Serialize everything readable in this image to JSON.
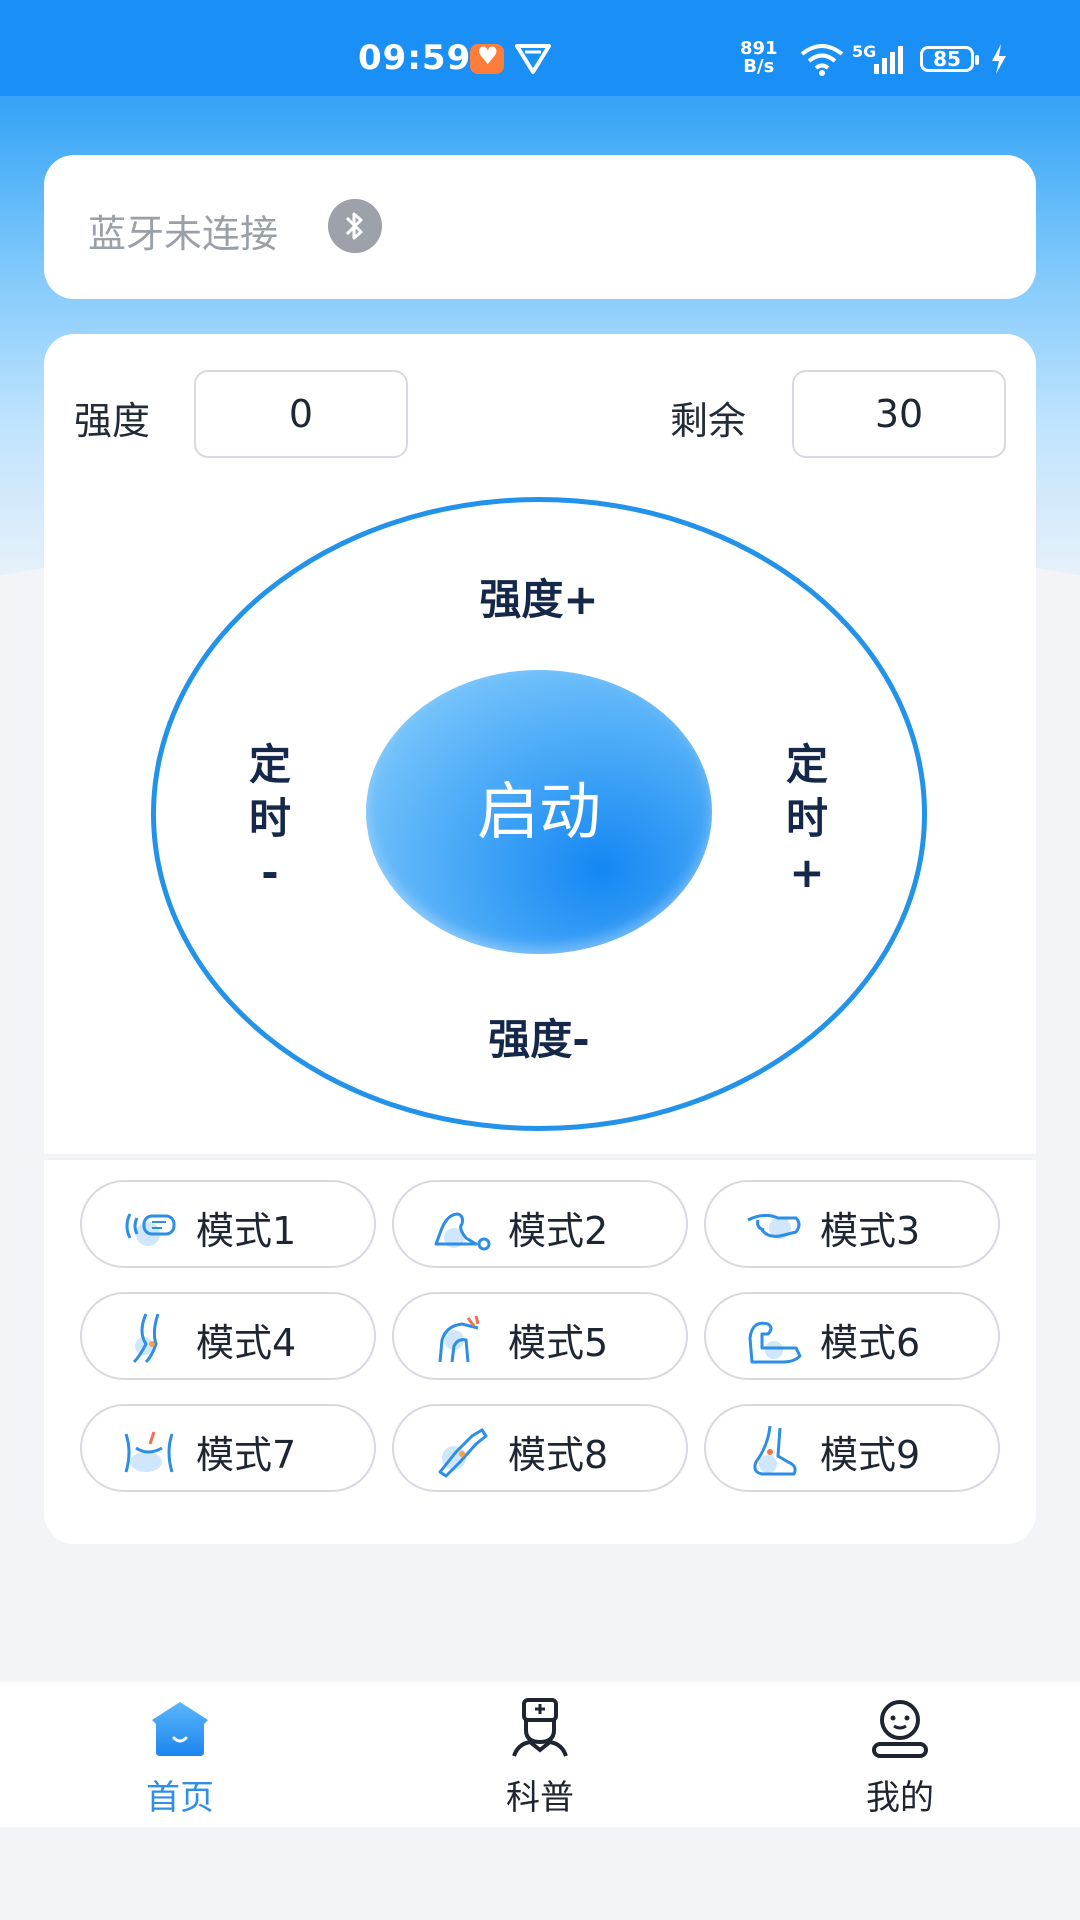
{
  "status_bar": {
    "time": "09:59",
    "net_speed_value": "891",
    "net_speed_unit": "B/s",
    "network_type": "5G",
    "battery": "85"
  },
  "bluetooth": {
    "status_label": "蓝牙未连接"
  },
  "controls": {
    "intensity_label": "强度",
    "intensity_value": "0",
    "remaining_label": "剩余",
    "remaining_value": "30",
    "intensity_up": "强度+",
    "intensity_down": "强度-",
    "timer_minus_1": "定",
    "timer_minus_2": "时",
    "timer_minus_3": "-",
    "timer_plus_1": "定",
    "timer_plus_2": "时",
    "timer_plus_3": "+",
    "start_label": "启动"
  },
  "modes": [
    {
      "label": "模式1"
    },
    {
      "label": "模式2"
    },
    {
      "label": "模式3"
    },
    {
      "label": "模式4"
    },
    {
      "label": "模式5"
    },
    {
      "label": "模式6"
    },
    {
      "label": "模式7"
    },
    {
      "label": "模式8"
    },
    {
      "label": "模式9"
    }
  ],
  "nav": {
    "home": "首页",
    "science": "科普",
    "mine": "我的"
  },
  "colors": {
    "primary": "#1a8ff5",
    "accent_blue": "#2393ea",
    "text_dark": "#15284a",
    "nav_active": "#2f8fe6"
  }
}
